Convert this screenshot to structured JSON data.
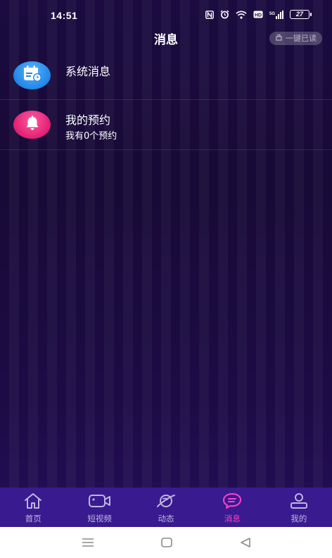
{
  "status_bar": {
    "time": "14:51",
    "battery": "27"
  },
  "header": {
    "title": "消息",
    "mark_all_read": "一键已读"
  },
  "messages": [
    {
      "title": "系统消息",
      "subtitle": ""
    },
    {
      "title": "我的预约",
      "subtitle": "我有0个预约"
    }
  ],
  "tabs": [
    {
      "label": "首页",
      "icon": "home-icon"
    },
    {
      "label": "短视频",
      "icon": "video-camera-icon"
    },
    {
      "label": "动态",
      "icon": "planet-icon"
    },
    {
      "label": "消息",
      "icon": "chat-bubble-icon",
      "active": true
    },
    {
      "label": "我的",
      "icon": "person-icon"
    }
  ],
  "colors": {
    "tab_bar": "#3a1a8f",
    "tab_active": "#ff43c8",
    "tab_inactive": "#bdb6e0",
    "system_avatar": "#2187e6",
    "reservation_avatar": "#e21f72"
  }
}
